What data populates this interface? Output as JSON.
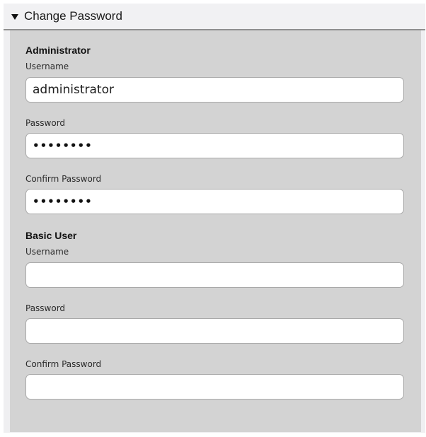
{
  "panel": {
    "title": "Change Password",
    "expanded": true,
    "toggle_icon": "triangle-down-icon"
  },
  "administrator": {
    "heading": "Administrator",
    "username_label": "Username",
    "username_value": "administrator",
    "password_label": "Password",
    "password_mask": "••••••••",
    "confirm_label": "Confirm Password",
    "confirm_mask": "••••••••"
  },
  "basic_user": {
    "heading": "Basic User",
    "username_label": "Username",
    "username_value": "",
    "password_label": "Password",
    "password_mask": "",
    "confirm_label": "Confirm Password",
    "confirm_mask": ""
  },
  "colors": {
    "panel_background": "#efeff1",
    "body_background": "#d3d3d3",
    "field_background": "#ffffff",
    "header_rule": "#8f8f8f"
  }
}
